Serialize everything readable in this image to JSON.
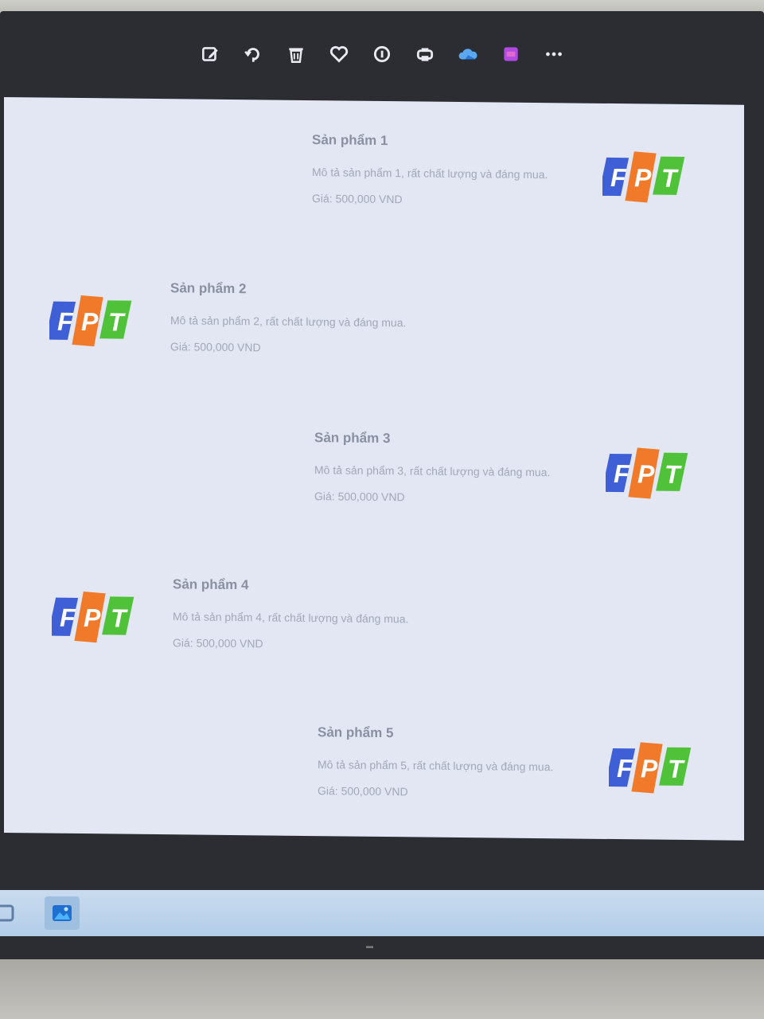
{
  "toolbar": {
    "icons": [
      "edit-icon",
      "rotate-icon",
      "trash-icon",
      "heart-icon",
      "info-icon",
      "print-icon",
      "onedrive-icon",
      "clipchamp-icon",
      "more-icon"
    ]
  },
  "products": [
    {
      "title": "Sản phẩm 1",
      "description": "Mô tả sản phẩm 1, rất chất lượng và đáng mua.",
      "price": "Giá: 500,000 VND",
      "logo": [
        "F",
        "P",
        "T"
      ]
    },
    {
      "title": "Sản phẩm 2",
      "description": "Mô tả sản phẩm 2, rất chất lượng và đáng mua.",
      "price": "Giá: 500,000 VND",
      "logo": [
        "F",
        "P",
        "T"
      ]
    },
    {
      "title": "Sản phẩm 3",
      "description": "Mô tả sản phẩm 3, rất chất lượng và đáng mua.",
      "price": "Giá: 500,000 VND",
      "logo": [
        "F",
        "P",
        "T"
      ]
    },
    {
      "title": "Sản phẩm 4",
      "description": "Mô tả sản phẩm 4, rất chất lượng và đáng mua.",
      "price": "Giá: 500,000 VND",
      "logo": [
        "F",
        "P",
        "T"
      ]
    },
    {
      "title": "Sản phẩm 5",
      "description": "Mô tả sản phẩm 5, rất chất lượng và đáng mua.",
      "price": "Giá: 500,000 VND",
      "logo": [
        "F",
        "P",
        "T"
      ]
    }
  ],
  "colors": {
    "logo_blue": "#3f5fd6",
    "logo_orange": "#f07a2a",
    "logo_green": "#4fc23a",
    "page_background": "#e2e7f3",
    "bezel": "#2c2d33"
  }
}
